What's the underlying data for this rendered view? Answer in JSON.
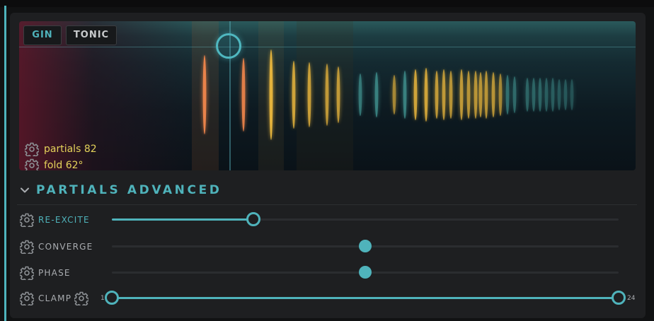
{
  "visualizer": {
    "tabs": [
      {
        "label": "GIN",
        "active": true
      },
      {
        "label": "TONIC",
        "active": false
      }
    ],
    "stats": [
      {
        "icon": "gear-icon",
        "text": "partials 82"
      },
      {
        "icon": "gear-icon",
        "text": "fold 62°"
      }
    ]
  },
  "section": {
    "title": "PARTIALS ADVANCED",
    "icon": "chevron-down-icon"
  },
  "params": [
    {
      "label": "RE-EXCITE",
      "value_fraction": 0.28,
      "active": true
    },
    {
      "label": "CONVERGE",
      "value_fraction": 0.5,
      "active": false
    },
    {
      "label": "PHASE",
      "value_fraction": 0.5,
      "active": false
    },
    {
      "label": "CLAMP",
      "range_min_label": "1",
      "range_max_label": "24",
      "low_fraction": 0.0,
      "high_fraction": 1.0,
      "active": false
    }
  ],
  "colors": {
    "accent": "#4fb3bb",
    "stat_text": "#e4d25a",
    "partial_orange": "#e8824a",
    "partial_gold": "#e3b23c",
    "partial_teal": "#3f8f8c"
  }
}
